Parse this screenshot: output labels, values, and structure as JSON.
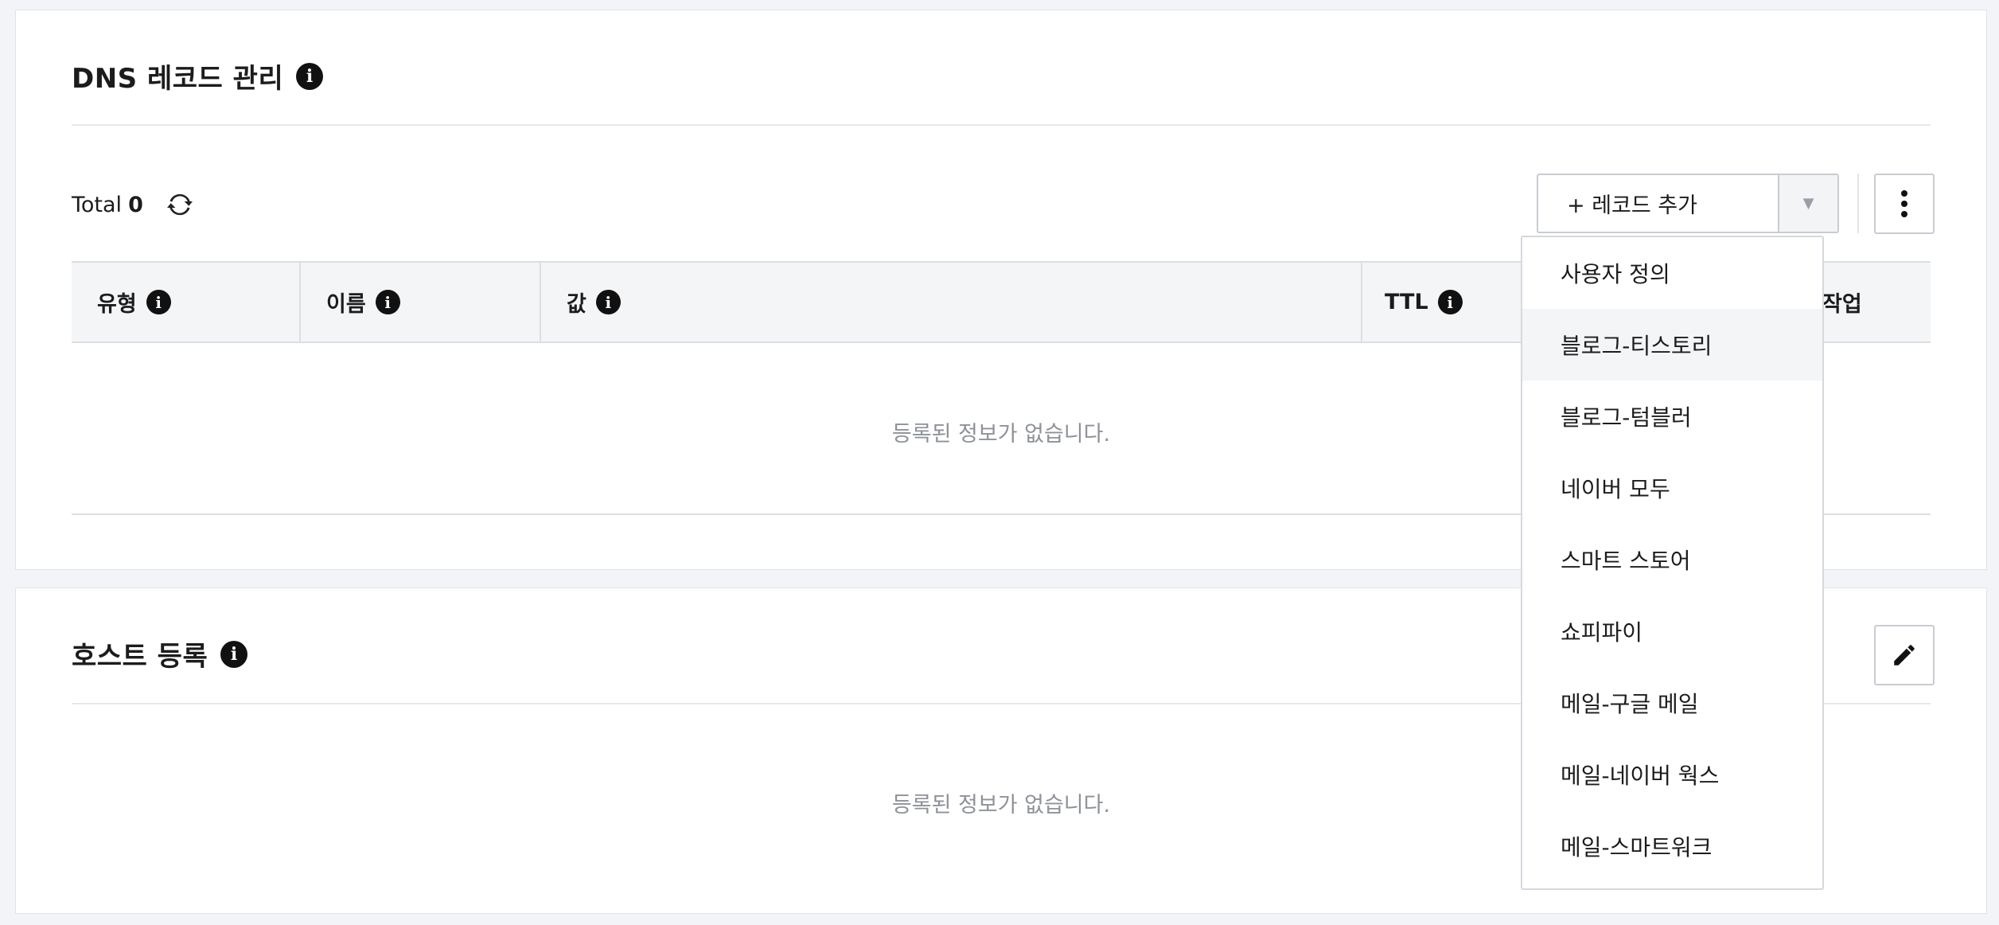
{
  "dns": {
    "title": "DNS 레코드 관리",
    "total_label": "Total",
    "total_count": "0",
    "add_button_label": "+ 레코드 추가",
    "columns": [
      "유형",
      "이름",
      "값",
      "TTL",
      "작업"
    ],
    "empty_text": "등록된 정보가 없습니다."
  },
  "host": {
    "title": "호스트 등록",
    "empty_text": "등록된 정보가 없습니다."
  },
  "dropdown": {
    "items": [
      "사용자 정의",
      "블로그-티스토리",
      "블로그-텀블러",
      "네이버 모두",
      "스마트 스토어",
      "쇼피파이",
      "메일-구글 메일",
      "메일-네이버 웍스",
      "메일-스마트워크"
    ],
    "hovered_index": 1
  },
  "icons": {
    "info": "info-icon",
    "refresh": "refresh-icon",
    "caret": "caret-down-icon",
    "kebab": "kebab-menu-icon",
    "edit": "pencil-icon"
  }
}
